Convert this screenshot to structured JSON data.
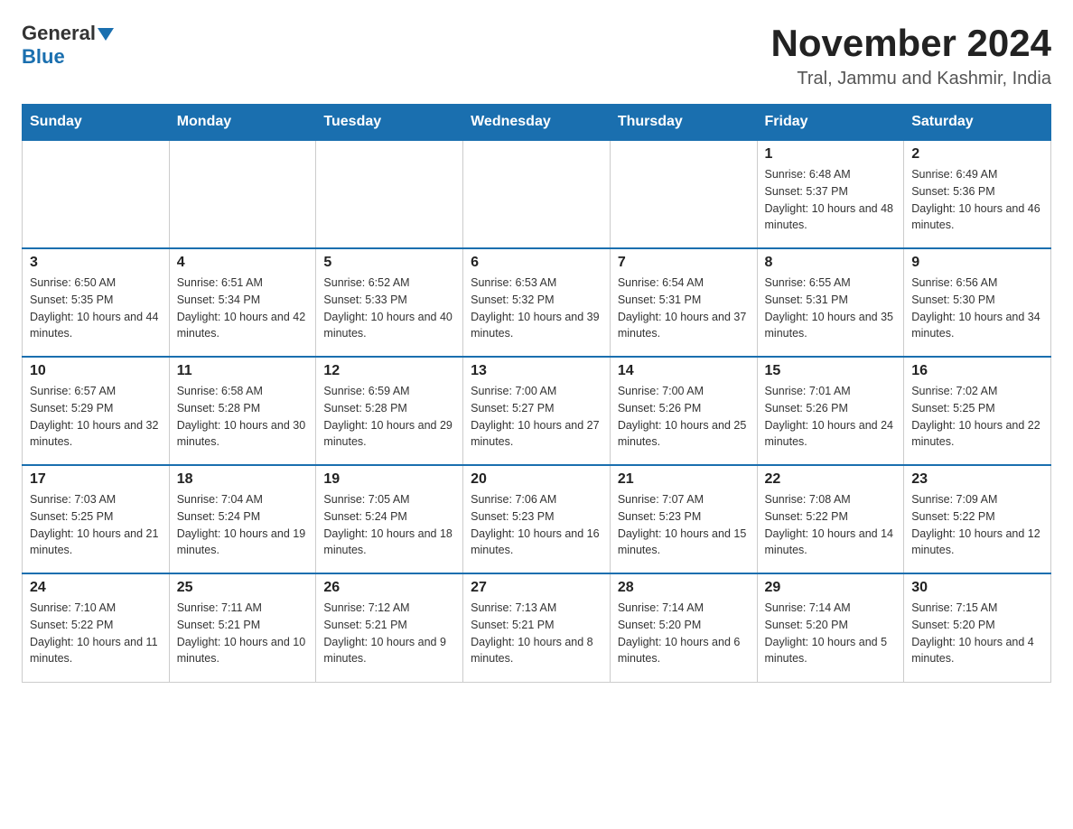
{
  "header": {
    "logo_general": "General",
    "logo_blue": "Blue",
    "month_title": "November 2024",
    "location": "Tral, Jammu and Kashmir, India"
  },
  "weekdays": [
    "Sunday",
    "Monday",
    "Tuesday",
    "Wednesday",
    "Thursday",
    "Friday",
    "Saturday"
  ],
  "weeks": [
    [
      {
        "day": "",
        "info": ""
      },
      {
        "day": "",
        "info": ""
      },
      {
        "day": "",
        "info": ""
      },
      {
        "day": "",
        "info": ""
      },
      {
        "day": "",
        "info": ""
      },
      {
        "day": "1",
        "info": "Sunrise: 6:48 AM\nSunset: 5:37 PM\nDaylight: 10 hours and 48 minutes."
      },
      {
        "day": "2",
        "info": "Sunrise: 6:49 AM\nSunset: 5:36 PM\nDaylight: 10 hours and 46 minutes."
      }
    ],
    [
      {
        "day": "3",
        "info": "Sunrise: 6:50 AM\nSunset: 5:35 PM\nDaylight: 10 hours and 44 minutes."
      },
      {
        "day": "4",
        "info": "Sunrise: 6:51 AM\nSunset: 5:34 PM\nDaylight: 10 hours and 42 minutes."
      },
      {
        "day": "5",
        "info": "Sunrise: 6:52 AM\nSunset: 5:33 PM\nDaylight: 10 hours and 40 minutes."
      },
      {
        "day": "6",
        "info": "Sunrise: 6:53 AM\nSunset: 5:32 PM\nDaylight: 10 hours and 39 minutes."
      },
      {
        "day": "7",
        "info": "Sunrise: 6:54 AM\nSunset: 5:31 PM\nDaylight: 10 hours and 37 minutes."
      },
      {
        "day": "8",
        "info": "Sunrise: 6:55 AM\nSunset: 5:31 PM\nDaylight: 10 hours and 35 minutes."
      },
      {
        "day": "9",
        "info": "Sunrise: 6:56 AM\nSunset: 5:30 PM\nDaylight: 10 hours and 34 minutes."
      }
    ],
    [
      {
        "day": "10",
        "info": "Sunrise: 6:57 AM\nSunset: 5:29 PM\nDaylight: 10 hours and 32 minutes."
      },
      {
        "day": "11",
        "info": "Sunrise: 6:58 AM\nSunset: 5:28 PM\nDaylight: 10 hours and 30 minutes."
      },
      {
        "day": "12",
        "info": "Sunrise: 6:59 AM\nSunset: 5:28 PM\nDaylight: 10 hours and 29 minutes."
      },
      {
        "day": "13",
        "info": "Sunrise: 7:00 AM\nSunset: 5:27 PM\nDaylight: 10 hours and 27 minutes."
      },
      {
        "day": "14",
        "info": "Sunrise: 7:00 AM\nSunset: 5:26 PM\nDaylight: 10 hours and 25 minutes."
      },
      {
        "day": "15",
        "info": "Sunrise: 7:01 AM\nSunset: 5:26 PM\nDaylight: 10 hours and 24 minutes."
      },
      {
        "day": "16",
        "info": "Sunrise: 7:02 AM\nSunset: 5:25 PM\nDaylight: 10 hours and 22 minutes."
      }
    ],
    [
      {
        "day": "17",
        "info": "Sunrise: 7:03 AM\nSunset: 5:25 PM\nDaylight: 10 hours and 21 minutes."
      },
      {
        "day": "18",
        "info": "Sunrise: 7:04 AM\nSunset: 5:24 PM\nDaylight: 10 hours and 19 minutes."
      },
      {
        "day": "19",
        "info": "Sunrise: 7:05 AM\nSunset: 5:24 PM\nDaylight: 10 hours and 18 minutes."
      },
      {
        "day": "20",
        "info": "Sunrise: 7:06 AM\nSunset: 5:23 PM\nDaylight: 10 hours and 16 minutes."
      },
      {
        "day": "21",
        "info": "Sunrise: 7:07 AM\nSunset: 5:23 PM\nDaylight: 10 hours and 15 minutes."
      },
      {
        "day": "22",
        "info": "Sunrise: 7:08 AM\nSunset: 5:22 PM\nDaylight: 10 hours and 14 minutes."
      },
      {
        "day": "23",
        "info": "Sunrise: 7:09 AM\nSunset: 5:22 PM\nDaylight: 10 hours and 12 minutes."
      }
    ],
    [
      {
        "day": "24",
        "info": "Sunrise: 7:10 AM\nSunset: 5:22 PM\nDaylight: 10 hours and 11 minutes."
      },
      {
        "day": "25",
        "info": "Sunrise: 7:11 AM\nSunset: 5:21 PM\nDaylight: 10 hours and 10 minutes."
      },
      {
        "day": "26",
        "info": "Sunrise: 7:12 AM\nSunset: 5:21 PM\nDaylight: 10 hours and 9 minutes."
      },
      {
        "day": "27",
        "info": "Sunrise: 7:13 AM\nSunset: 5:21 PM\nDaylight: 10 hours and 8 minutes."
      },
      {
        "day": "28",
        "info": "Sunrise: 7:14 AM\nSunset: 5:20 PM\nDaylight: 10 hours and 6 minutes."
      },
      {
        "day": "29",
        "info": "Sunrise: 7:14 AM\nSunset: 5:20 PM\nDaylight: 10 hours and 5 minutes."
      },
      {
        "day": "30",
        "info": "Sunrise: 7:15 AM\nSunset: 5:20 PM\nDaylight: 10 hours and 4 minutes."
      }
    ]
  ]
}
